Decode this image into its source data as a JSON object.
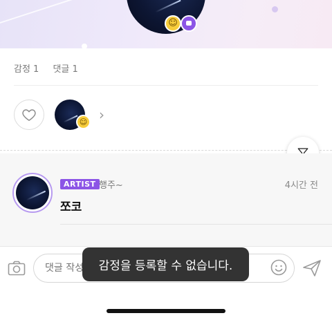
{
  "header": {
    "hero_emoji_icon": "smiley-face",
    "hero_chat_icon": "chat-bubble"
  },
  "stats": {
    "emotion_label": "감정 1",
    "comment_label": "댓글 1"
  },
  "reactions": {
    "like_icon": "heart-outline",
    "reactor_emoji_icon": "smiley-face",
    "more_icon": "chevron-right"
  },
  "filter": {
    "icon": "filter-funnel"
  },
  "comment": {
    "badge": "ARTIST",
    "author": "행주~",
    "time": "4시간 전",
    "text": "쪼코"
  },
  "composer": {
    "placeholder": "댓글 작성",
    "camera_icon": "camera",
    "emoji_icon": "smiley-outline",
    "send_icon": "paper-plane"
  },
  "toast": {
    "message": "감정을 등록할 수 없습니다."
  },
  "colors": {
    "accent": "#8c55e6",
    "emoji_yellow": "#f7cd3b",
    "toast_bg": "#333333"
  }
}
